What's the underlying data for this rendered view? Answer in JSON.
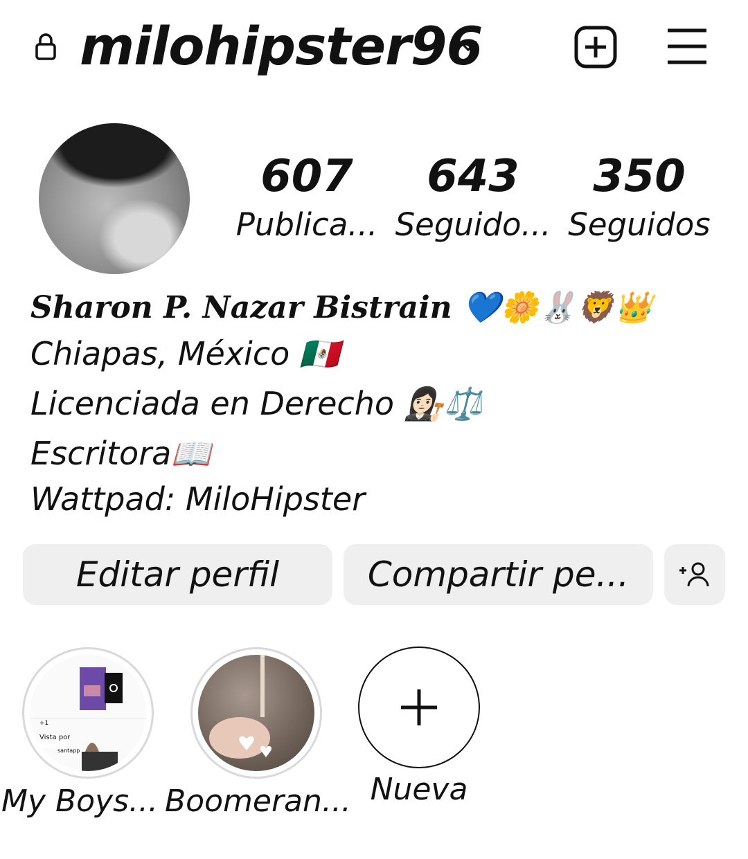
{
  "header": {
    "username": "milohipster96"
  },
  "profile": {
    "stats": [
      {
        "value": "607",
        "label": "Publica..."
      },
      {
        "value": "643",
        "label": "Seguido..."
      },
      {
        "value": "350",
        "label": "Seguidos"
      }
    ],
    "bio": {
      "name": "Sharon P. Nazar Bistrain 💙🌼🐰🦁👑",
      "line1": "Chiapas, México 🇲🇽",
      "line2": "Licenciada en Derecho 👩🏻‍⚖️⚖️",
      "line3": "Escritora📖",
      "line4": "Wattpad: MiloHipster"
    }
  },
  "actions": {
    "edit_profile": "Editar perfil",
    "share_profile": "Compartir pe..."
  },
  "highlights": [
    {
      "label": "My Boys..."
    },
    {
      "label": "Boomeran..."
    },
    {
      "label": "Nueva"
    }
  ],
  "story_preview": {
    "views_label": "Vista por",
    "count_label": "+1",
    "app_label": "santapp"
  }
}
